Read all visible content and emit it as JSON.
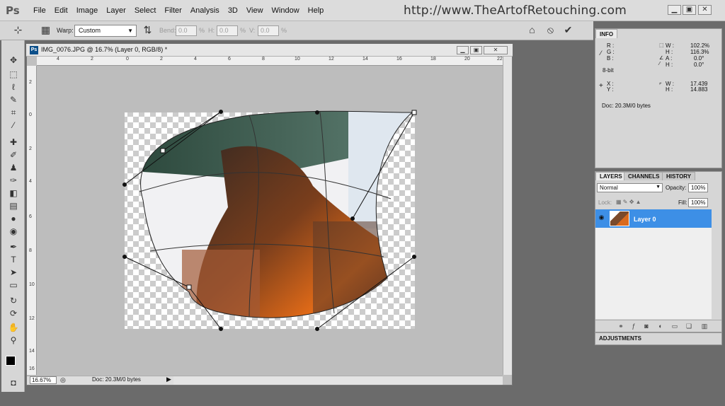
{
  "app": {
    "logo": "Ps"
  },
  "menu": [
    "File",
    "Edit",
    "Image",
    "Layer",
    "Select",
    "Filter",
    "Analysis",
    "3D",
    "View",
    "Window",
    "Help"
  ],
  "watermark": "http://www.TheArtofRetouching.com",
  "window_controls": {
    "minimize": "▁",
    "restore": "▣",
    "close": "✕"
  },
  "options": {
    "warp_label": "Warp:",
    "warp_value": "Custom",
    "bend_label": "Bend:",
    "bend_value": "0.0",
    "bend_unit": "%",
    "h_label": "H:",
    "h_value": "0.0",
    "h_unit": "%",
    "v_label": "V:",
    "v_value": "0.0",
    "v_unit": "%",
    "cancel_icon": "⦸",
    "commit_icon": "✔"
  },
  "tools": [
    "move",
    "marquee",
    "lasso",
    "quick-select",
    "crop",
    "eyedropper",
    "healing",
    "brush",
    "clone-stamp",
    "history-brush",
    "eraser",
    "gradient",
    "blur",
    "dodge",
    "pen",
    "type",
    "path-select",
    "shape",
    "3d-rotate",
    "3d-orbit",
    "hand",
    "zoom"
  ],
  "document": {
    "icon": "Ps",
    "title": "IMG_0076.JPG @ 16.7% (Layer 0, RGB/8) *",
    "zoom": "16.67%",
    "doc_size": "Doc: 20.3M/0 bytes",
    "ruler_top": [
      "4",
      "2",
      "0",
      "2",
      "4",
      "6",
      "8",
      "10",
      "12",
      "14",
      "16",
      "18",
      "20",
      "22"
    ],
    "ruler_left": [
      "2",
      "0",
      "2",
      "4",
      "6",
      "8",
      "10",
      "12",
      "14",
      "16"
    ]
  },
  "info_panel": {
    "tab": "INFO",
    "r": "R :",
    "g": "G :",
    "b": "B :",
    "bit": "8-bit",
    "x": "X :",
    "y": "Y :",
    "w_pct_label": "W :",
    "w_pct": "102.2%",
    "h_pct_label": "H :",
    "h_pct": "116.3%",
    "a_label": "A :",
    "a_val": "0.0°",
    "hh_label": "H :",
    "hh_val": "0.0°",
    "w_label": "W :",
    "w_val": "17.439",
    "h2_label": "H :",
    "h2_val": "14.883",
    "doc": "Doc: 20.3M/0 bytes"
  },
  "layers_panel": {
    "tabs": [
      "LAYERS",
      "CHANNELS",
      "HISTORY"
    ],
    "blend_mode": "Normal",
    "opacity_label": "Opacity:",
    "opacity": "100%",
    "lock_label": "Lock:",
    "fill_label": "Fill:",
    "fill": "100%",
    "layer_name": "Layer 0"
  },
  "adjustments_tab": "ADJUSTMENTS",
  "colors": {
    "selection": "#3d8fe6",
    "canvas": "#bdbdbd"
  }
}
